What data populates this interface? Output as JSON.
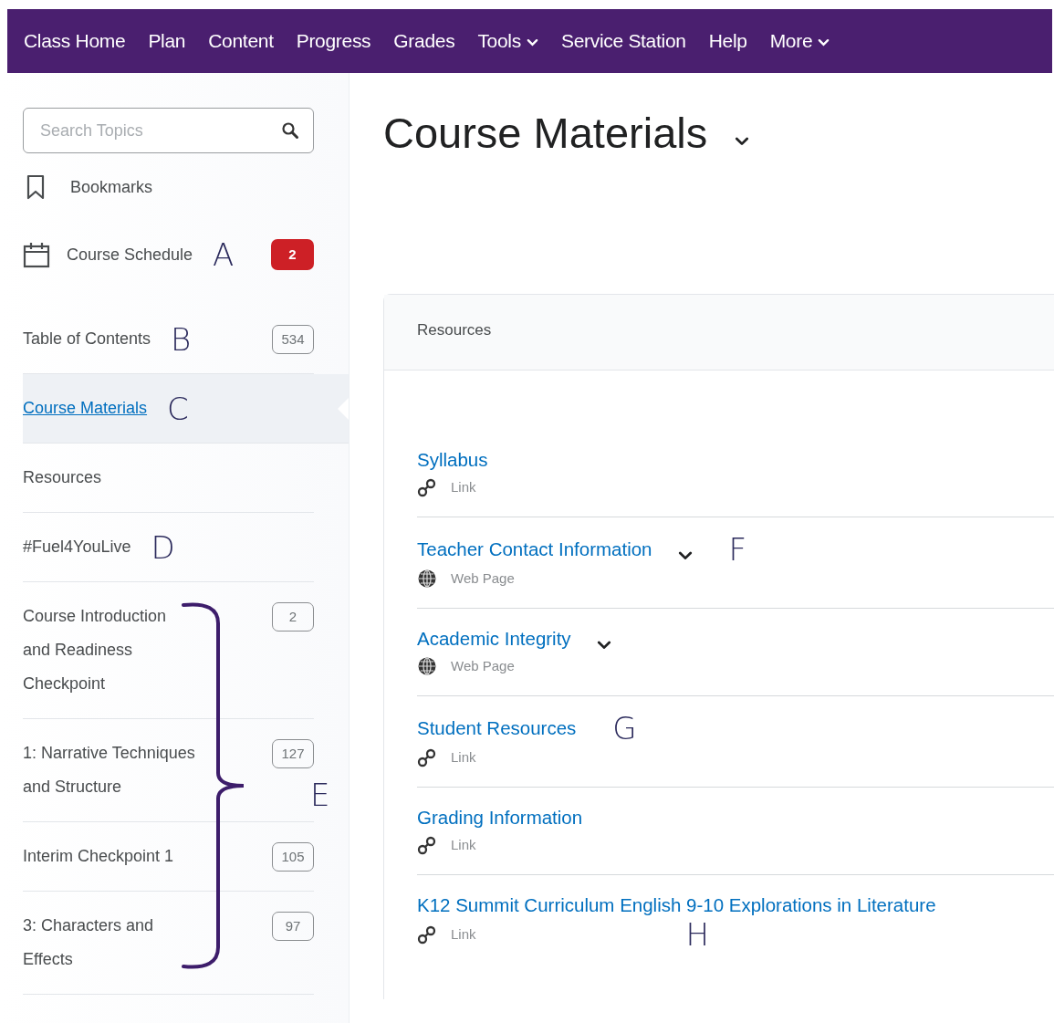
{
  "nav": [
    {
      "label": "Class Home",
      "dropdown": false
    },
    {
      "label": "Plan",
      "dropdown": false
    },
    {
      "label": "Content",
      "dropdown": false
    },
    {
      "label": "Progress",
      "dropdown": false
    },
    {
      "label": "Grades",
      "dropdown": false
    },
    {
      "label": "Tools",
      "dropdown": true
    },
    {
      "label": "Service Station",
      "dropdown": false
    },
    {
      "label": "Help",
      "dropdown": false
    },
    {
      "label": "More",
      "dropdown": true
    }
  ],
  "sidebar": {
    "search": {
      "placeholder": "Search Topics"
    },
    "items": [
      {
        "kind": "bookmarks",
        "label": "Bookmarks"
      },
      {
        "kind": "schedule",
        "label": "Course Schedule",
        "annotation": "A",
        "badge": {
          "text": "2",
          "kind": "alert"
        }
      },
      {
        "kind": "topic",
        "label": "Table of Contents",
        "annotation": "B",
        "badge": {
          "text": "534",
          "kind": "count"
        },
        "selected": false
      },
      {
        "kind": "topic",
        "label": "Course Materials",
        "annotation": "C",
        "selected": true
      },
      {
        "kind": "subtopic",
        "label": "Resources",
        "selected": false
      },
      {
        "kind": "topic",
        "label": "#Fuel4YouLive",
        "annotation": "D",
        "selected": false
      }
    ],
    "modules": {
      "annotation": "E",
      "items": [
        {
          "lines": [
            "Course Introduction",
            "and Readiness",
            "Checkpoint"
          ],
          "badge": "2",
          "selected": false
        },
        {
          "lines": [
            "1: Narrative Techniques",
            "and Structure"
          ],
          "badge": "127",
          "selected": false
        },
        {
          "lines": [
            "Interim Checkpoint 1"
          ],
          "badge": "105",
          "selected": false
        },
        {
          "lines": [
            "3: Characters and",
            "Effects"
          ],
          "badge": "97",
          "selected": false
        }
      ]
    }
  },
  "main": {
    "title": "Course Materials",
    "title_menu": true,
    "panel": {
      "header": "Resources",
      "items": [
        {
          "title": "Syllabus",
          "kind": "link",
          "type_label": "Link",
          "menu": false
        },
        {
          "title": "Teacher Contact Information",
          "kind": "webpage",
          "type_label": "Web Page",
          "menu": true,
          "annotation": {
            "text": "F",
            "kind": "title"
          }
        },
        {
          "title": "Academic Integrity",
          "kind": "webpage",
          "type_label": "Web Page",
          "menu": true
        },
        {
          "title": "Student Resources",
          "kind": "link",
          "type_label": "Link",
          "menu": false,
          "annotation": {
            "text": "G",
            "kind": "title"
          }
        },
        {
          "title": "Grading Information",
          "kind": "link",
          "type_label": "Link",
          "menu": false
        },
        {
          "title": "K12 Summit Curriculum English 9-10 Explorations in Literature",
          "kind": "link",
          "type_label": "Link",
          "menu": false,
          "annotation": {
            "text": "H",
            "kind": "type"
          }
        }
      ]
    }
  }
}
